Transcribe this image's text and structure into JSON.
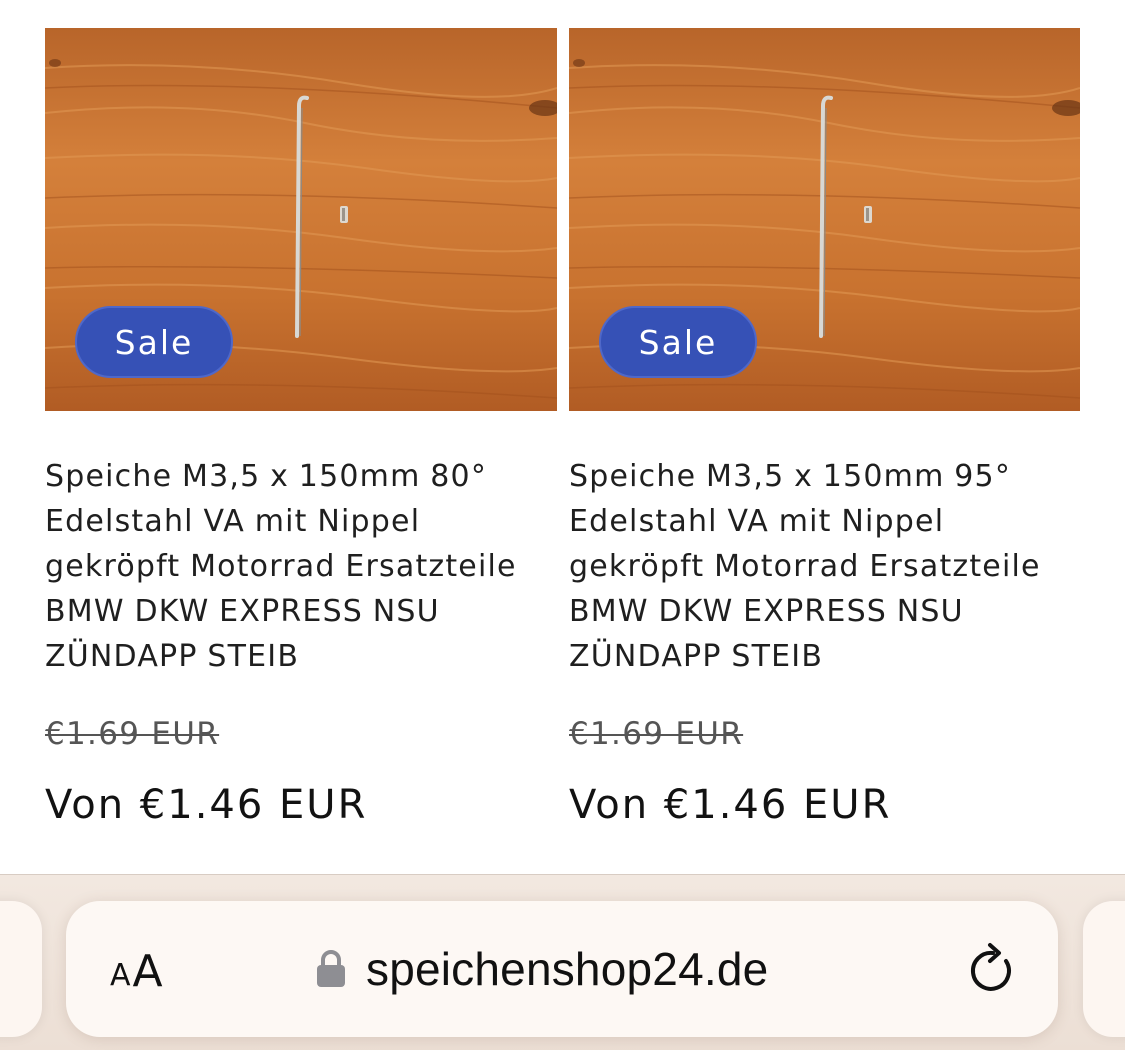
{
  "products": [
    {
      "badge": "Sale",
      "title": "Speiche M3,5 x 150mm 80° Edelstahl VA mit Nippel gekröpft Motorrad Ersatzteile BMW DKW EXPRESS NSU ZÜNDAPP STEIB",
      "price_old": "€1.69 EUR",
      "price_new": "Von €1.46 EUR"
    },
    {
      "badge": "Sale",
      "title": "Speiche M3,5 x 150mm 95° Edelstahl VA mit Nippel gekröpft Motorrad Ersatzteile BMW DKW EXPRESS NSU ZÜNDAPP STEIB",
      "price_old": "€1.69 EUR",
      "price_new": "Von €1.46 EUR"
    }
  ],
  "browser": {
    "aa_small": "A",
    "aa_big": "A",
    "url": "speichenshop24.de",
    "lock_icon": "lock-icon",
    "reload_icon": "reload-icon"
  },
  "colors": {
    "badge": "#3651b6",
    "wood": "#c9712f"
  }
}
